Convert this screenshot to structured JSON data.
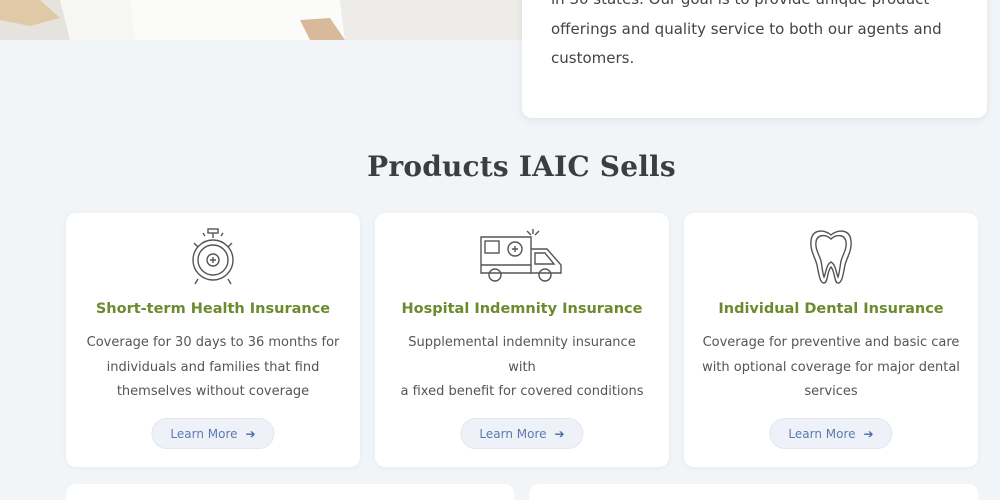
{
  "about": {
    "text_line1": "in 30 states. Our goal is to provide unique product",
    "text_line2": "offerings and quality service to both our agents and",
    "text_line3": "customers."
  },
  "section": {
    "title": "Products IAIC Sells"
  },
  "products": [
    {
      "icon": "stopwatch-medical-icon",
      "title": "Short-term Health Insurance",
      "desc_line1": "Coverage for 30 days to 36 months for",
      "desc_line2": "individuals and families that find",
      "desc_line3": "themselves without coverage",
      "button": "Learn More"
    },
    {
      "icon": "ambulance-icon",
      "title": "Hospital Indemnity Insurance",
      "desc_line1": "Supplemental indemnity insurance with",
      "desc_line2": "a fixed benefit for covered conditions",
      "desc_line3": "",
      "button": "Learn More"
    },
    {
      "icon": "tooth-icon",
      "title": "Individual Dental Insurance",
      "desc_line1": "Coverage for preventive and basic care",
      "desc_line2": "with optional coverage for major dental",
      "desc_line3": "services",
      "button": "Learn More"
    }
  ],
  "colors": {
    "background": "#f2f5f8",
    "title_green": "#6b8b2e",
    "button_text": "#5b7bb0"
  }
}
